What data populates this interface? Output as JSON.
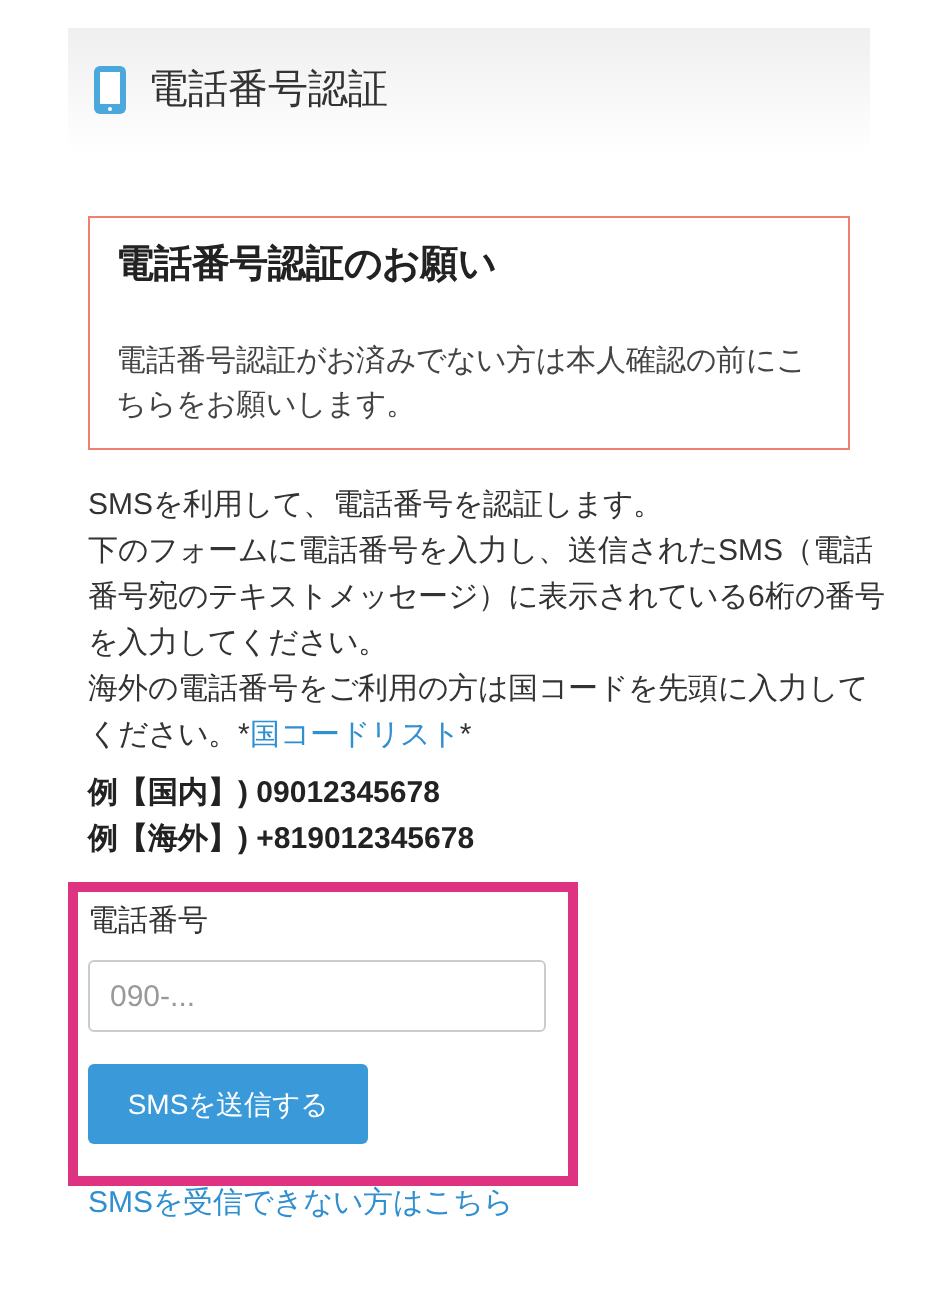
{
  "header": {
    "title": "電話番号認証"
  },
  "notice": {
    "title": "電話番号認証のお願い",
    "text": "電話番号認証がお済みでない方は本人確認の前にこちらをお願いします。"
  },
  "description": [
    {
      "text": "SMSを利用して、電話番号を認証します。"
    },
    {
      "text": "下のフォームに電話番号を入力し、送信されたSMS（電話番号宛のテキストメッセージ）に表示されている6桁の番号を入力してください。"
    },
    {
      "text": "海外の電話番号をご利用の方は国コードを先頭に入力してください。*",
      "link": "国コードリスト",
      "after": "*"
    }
  ],
  "examples": [
    "例【国内】) 09012345678",
    "例【海外】) +819012345678"
  ],
  "form": {
    "label": "電話番号",
    "placeholder": "090-...",
    "submit": "SMSを送信する"
  },
  "help_link": "SMSを受信できない方はこちら"
}
